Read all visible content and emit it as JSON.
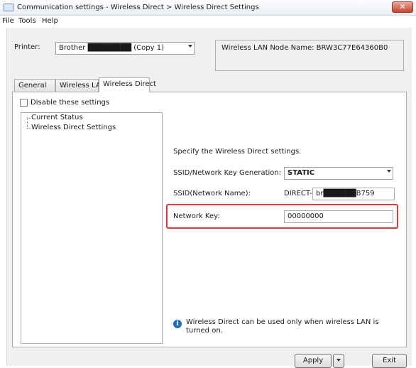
{
  "window": {
    "title": "Communication settings - Wireless Direct > Wireless Direct Settings",
    "close_label": "✕"
  },
  "menu": {
    "items": [
      "File",
      "Tools",
      "Help"
    ]
  },
  "printer": {
    "label": "Printer:",
    "selected": "Brother ████████ (Copy 1)",
    "node_name": "Wireless LAN Node Name: BRW3C77E64360B0"
  },
  "tabs": [
    "General",
    "Wireless LAN",
    "Wireless Direct"
  ],
  "disable_label": "Disable these settings",
  "tree": {
    "items": [
      "Current Status",
      "Wireless Direct Settings"
    ]
  },
  "settings": {
    "heading": "Specify the Wireless Direct settings.",
    "ssid_gen_label": "SSID/Network Key Generation:",
    "ssid_gen_value": "STATIC",
    "ssid_label": "SSID(Network Name):",
    "ssid_prefix": "DIRECT-",
    "ssid_value": "br██████B759",
    "key_label": "Network Key:",
    "key_value": "00000000",
    "info_note": "Wireless Direct can be used only when wireless LAN is turned on."
  },
  "buttons": {
    "apply": "Apply",
    "exit": "Exit"
  },
  "colors": {
    "highlight": "#d93b3b",
    "info": "#1f6fbf"
  }
}
